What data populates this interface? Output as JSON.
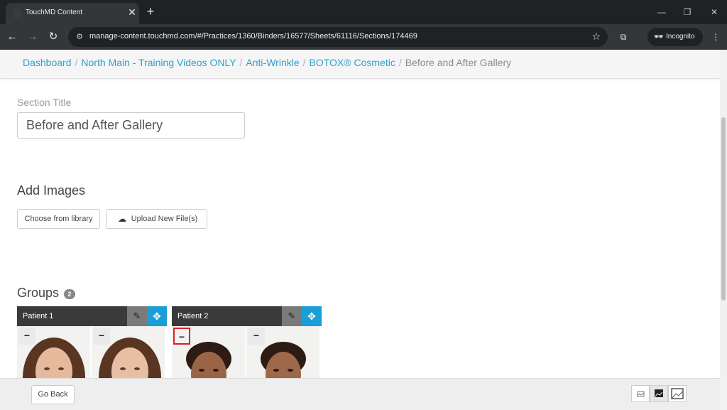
{
  "browser": {
    "tab_title": "TouchMD Content",
    "tab_close": "✕",
    "new_tab": "+",
    "url": "manage-content.touchmd.com/#/Practices/1360/Binders/16577/Sheets/61116/Sections/174469",
    "incognito_label": "Incognito"
  },
  "breadcrumb": {
    "items": [
      "Dashboard",
      "North Main - Training Videos ONLY",
      "Anti-Wrinkle",
      "BOTOX® Cosmetic"
    ],
    "current": "Before and After Gallery",
    "separator": "/"
  },
  "section": {
    "label": "Section Title",
    "value": "Before and After Gallery"
  },
  "add_images": {
    "heading": "Add Images",
    "choose_label": "Choose from library",
    "upload_label": "Upload New File(s)"
  },
  "groups": {
    "heading": "Groups",
    "count": "2",
    "items": [
      {
        "title": "Patient 1"
      },
      {
        "title": "Patient 2"
      }
    ]
  },
  "footer": {
    "go_back_label": "Go Back"
  },
  "colors": {
    "accent": "#1a9ed8",
    "link": "#2c9fd1",
    "group_header": "#3a3a3a",
    "highlight": "#e02020"
  },
  "icons": [
    "favicon-icon",
    "back-icon",
    "forward-icon",
    "reload-icon",
    "site-info-icon",
    "star-icon",
    "lens-icon",
    "incognito-icon",
    "menu-icon",
    "upload-cloud-icon",
    "pencil-icon",
    "move-icon",
    "minus-icon",
    "image-small-icon",
    "image-medium-icon",
    "image-large-icon"
  ]
}
